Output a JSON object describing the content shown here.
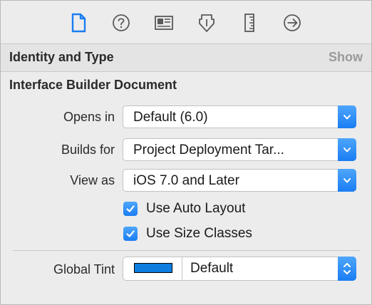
{
  "toolbar": {
    "icons": [
      "file-inspector-icon",
      "quick-help-icon",
      "identity-inspector-icon",
      "attributes-inspector-icon",
      "size-inspector-icon",
      "connections-inspector-icon"
    ],
    "active_color": "#1a7df3",
    "inactive_color": "#5a5a5a"
  },
  "identity_section": {
    "title": "Identity and Type",
    "show_label": "Show"
  },
  "ib_document": {
    "title": "Interface Builder Document",
    "opens_in": {
      "label": "Opens in",
      "value": "Default (6.0)"
    },
    "builds_for": {
      "label": "Builds for",
      "value": "Project Deployment Tar..."
    },
    "view_as": {
      "label": "View as",
      "value": "iOS 7.0 and Later"
    },
    "use_auto_layout": {
      "label": "Use Auto Layout",
      "checked": true
    },
    "use_size_classes": {
      "label": "Use Size Classes",
      "checked": true
    },
    "global_tint": {
      "label": "Global Tint",
      "value": "Default",
      "swatch_color": "#0b7ee0"
    }
  },
  "colors": {
    "accent": "#1a7df3",
    "panel_bg": "#ececec"
  }
}
